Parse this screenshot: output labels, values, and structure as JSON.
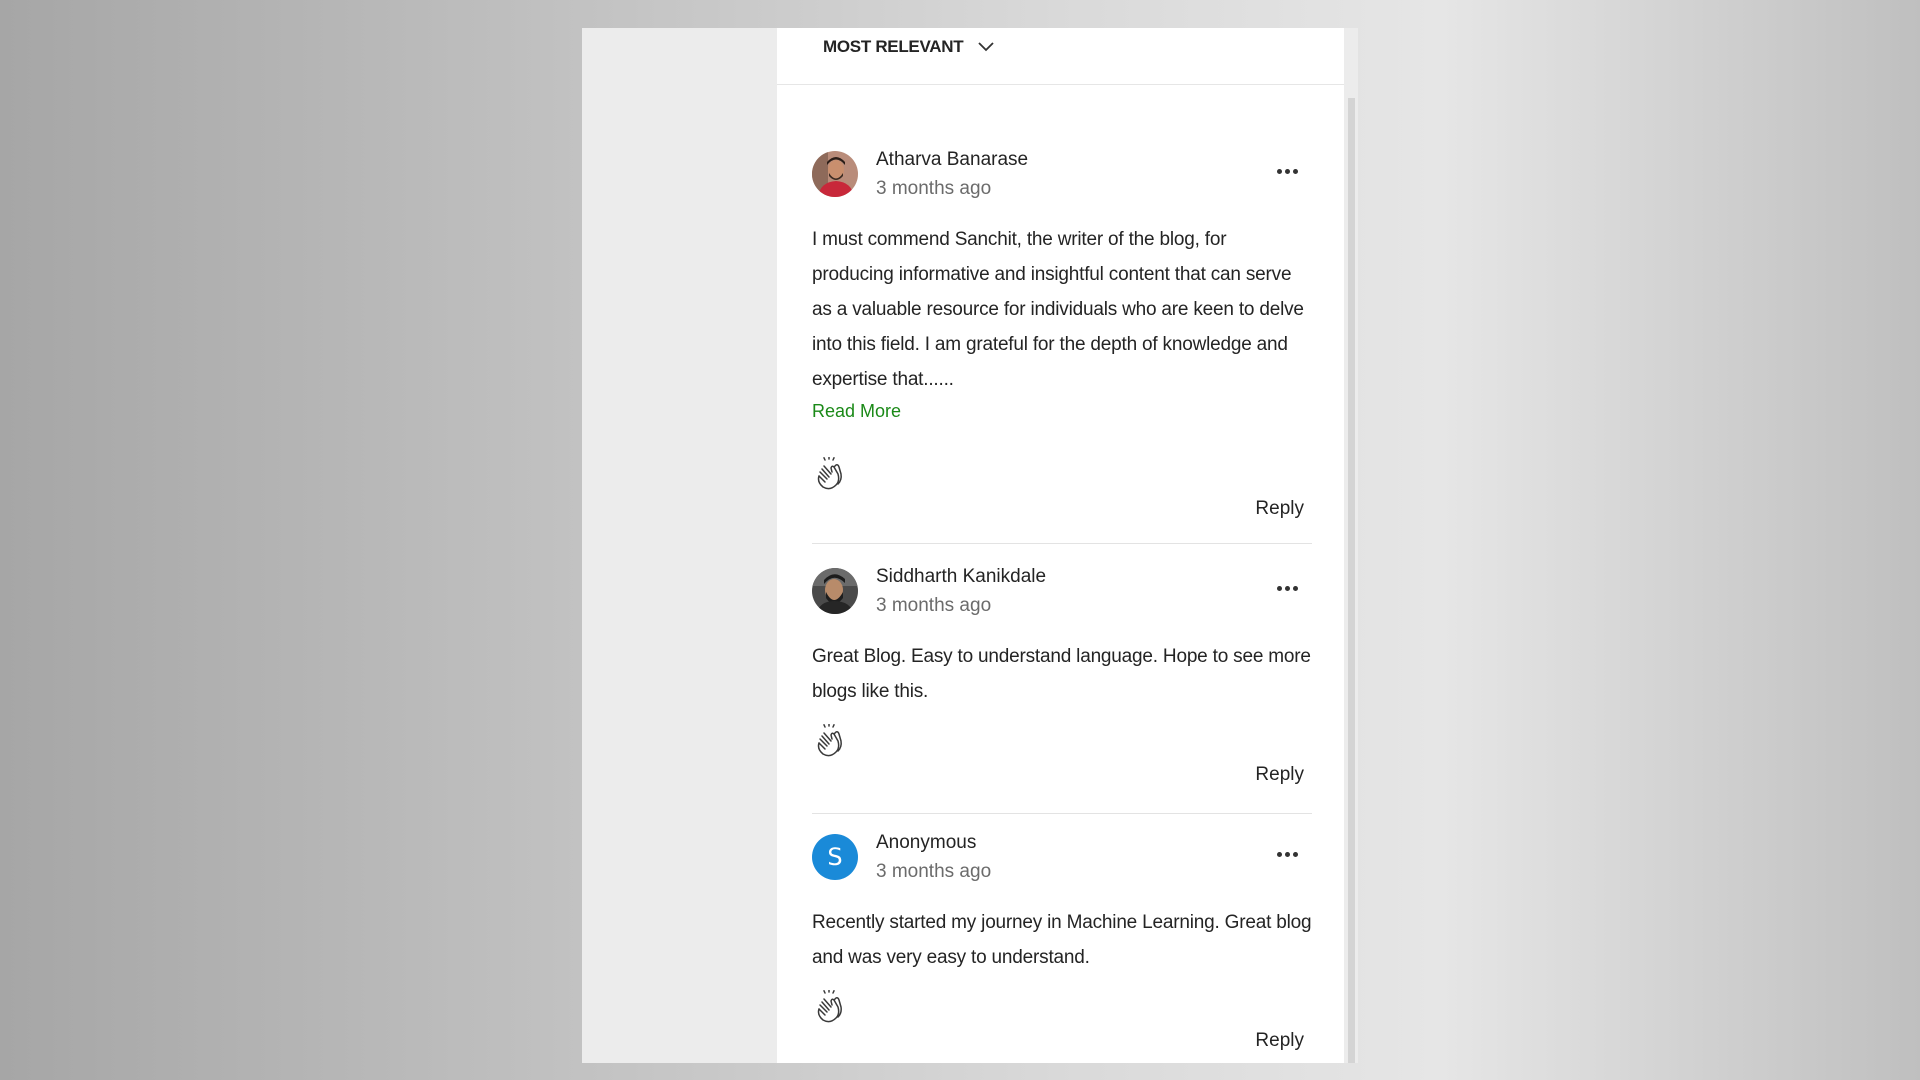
{
  "sort": {
    "label": "MOST RELEVANT"
  },
  "colors": {
    "accent_green": "#1a8917",
    "anonymous_avatar": "#1a8ad8"
  },
  "comments": [
    {
      "author": "Atharva Banarase",
      "time": "3 months ago",
      "text": "I must commend Sanchit, the writer of the blog, for producing informative and insightful content that can serve as a valuable resource for individuals who are keen to delve into this field. I am grateful for the depth of knowledge and expertise that......",
      "read_more": "Read More",
      "reply": "Reply",
      "avatar": "photo"
    },
    {
      "author": "Siddharth Kanikdale",
      "time": "3 months ago",
      "text": "Great Blog. Easy to understand language. Hope to see more blogs like this.",
      "reply": "Reply",
      "avatar": "photo"
    },
    {
      "author": "Anonymous",
      "time": "3 months ago",
      "text": "Recently started my journey in Machine Learning. Great blog and was very easy to understand.",
      "reply": "Reply",
      "avatar_letter": "S"
    }
  ],
  "icons": {
    "more": "more-horizontal-icon",
    "clap": "clap-icon",
    "sort": "chevron-down-icon"
  }
}
